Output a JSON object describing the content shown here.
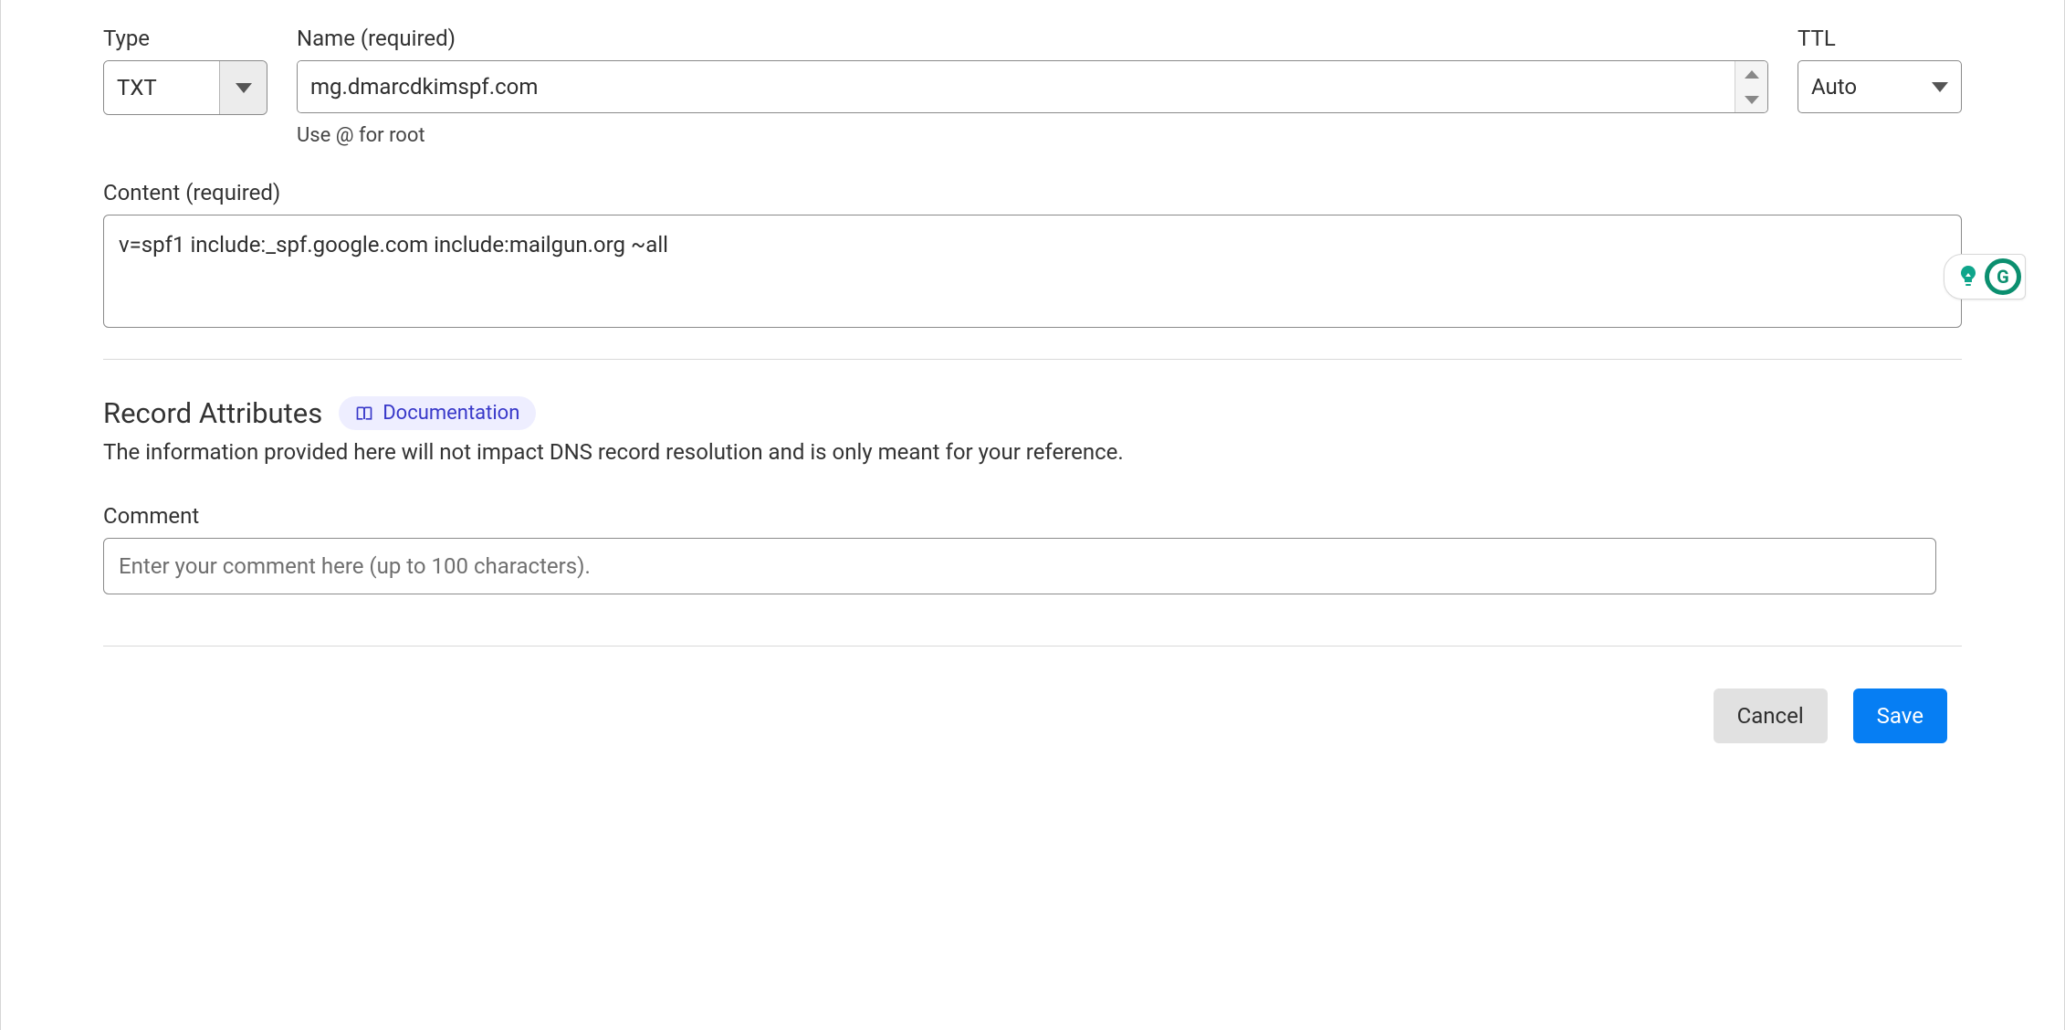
{
  "labels": {
    "type": "Type",
    "name": "Name (required)",
    "ttl": "TTL",
    "name_hint": "Use @ for root",
    "content": "Content (required)",
    "record_attributes": "Record Attributes",
    "documentation": "Documentation",
    "attrs_description": "The information provided here will not impact DNS record resolution and is only meant for your reference.",
    "comment": "Comment"
  },
  "values": {
    "type": "TXT",
    "name": "mg.dmarcdkimspf.com",
    "ttl": "Auto",
    "content": "v=spf1 include:_spf.google.com include:mailgun.org ~all",
    "comment": ""
  },
  "placeholders": {
    "comment": "Enter your comment here (up to 100 characters)."
  },
  "actions": {
    "cancel": "Cancel",
    "save": "Save"
  },
  "grammarly": {
    "letter": "G"
  },
  "colors": {
    "primary": "#067ef3",
    "link": "#3838c9",
    "brand_green": "#0b8f6f"
  }
}
